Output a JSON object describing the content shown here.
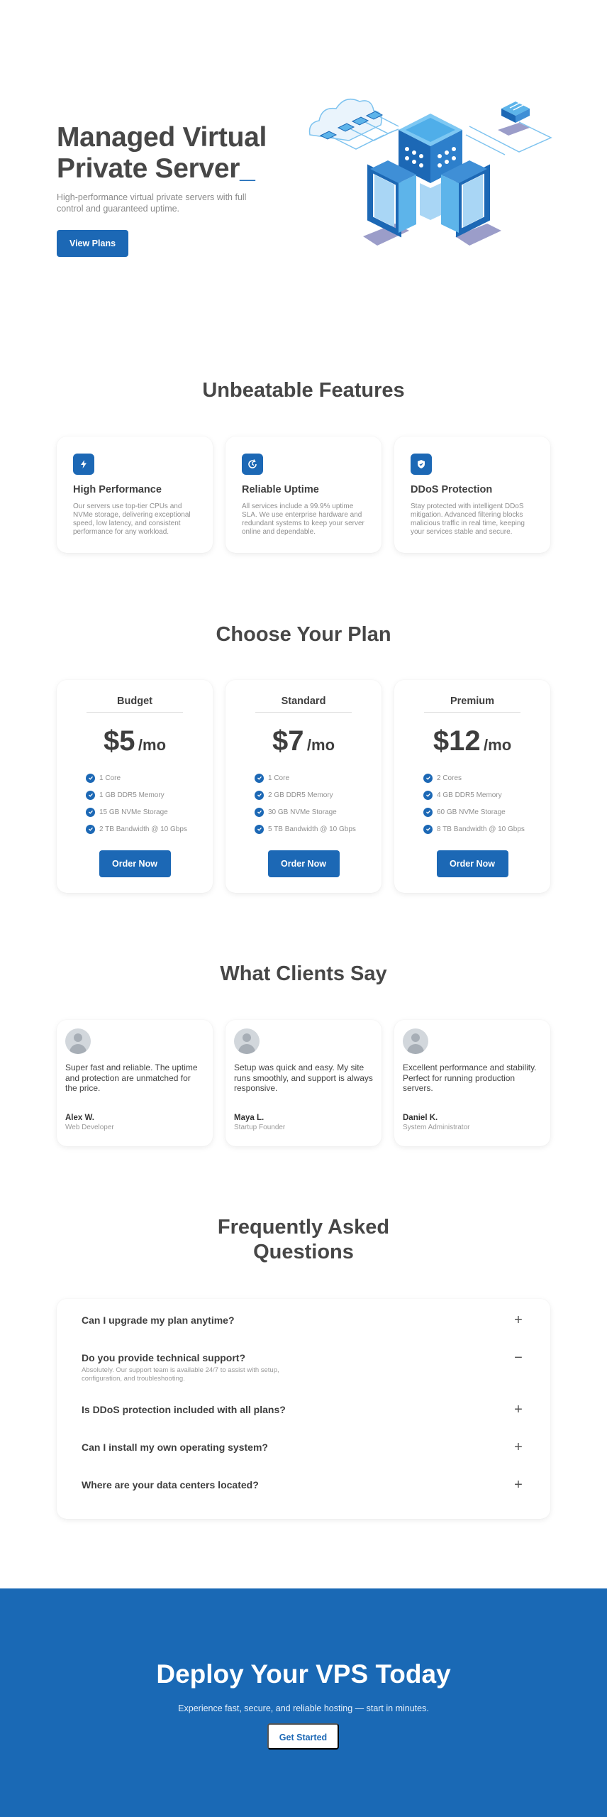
{
  "hero": {
    "title_line1": "Managed Virtual",
    "title_line2": "Private Server",
    "cursor": "_",
    "subtitle": "High-performance virtual private servers with full control and guaranteed uptime.",
    "button": "View Plans"
  },
  "features": {
    "title": "Unbeatable Features",
    "items": [
      {
        "icon": "bolt-icon",
        "title": "High Performance",
        "desc": "Our servers use top-tier CPUs and NVMe storage, delivering exceptional speed, low latency, and consistent performance for any workload."
      },
      {
        "icon": "clock-refresh-icon",
        "title": "Reliable Uptime",
        "desc": "All services include a 99.9% uptime SLA. We use enterprise hardware and redundant systems to keep your server online and dependable."
      },
      {
        "icon": "shield-icon",
        "title": "DDoS Protection",
        "desc": "Stay protected with intelligent DDoS mitigation. Advanced filtering blocks malicious traffic in real time, keeping your services stable and secure."
      }
    ]
  },
  "plans": {
    "title": "Choose Your Plan",
    "items": [
      {
        "name": "Budget",
        "price": "$5",
        "per": "/mo",
        "features": [
          "1 Core",
          "1 GB DDR5 Memory",
          "15 GB NVMe Storage",
          "2 TB Bandwidth @ 10 Gbps"
        ],
        "button": "Order Now"
      },
      {
        "name": "Standard",
        "price": "$7",
        "per": "/mo",
        "features": [
          "1 Core",
          "2 GB DDR5 Memory",
          "30 GB NVMe Storage",
          "5 TB Bandwidth @ 10 Gbps"
        ],
        "button": "Order Now"
      },
      {
        "name": "Premium",
        "price": "$12",
        "per": "/mo",
        "features": [
          "2 Cores",
          "4 GB DDR5 Memory",
          "60 GB NVMe Storage",
          "8 TB Bandwidth @ 10 Gbps"
        ],
        "button": "Order Now"
      }
    ]
  },
  "testimonials": {
    "title": "What Clients Say",
    "items": [
      {
        "quote": "Super fast and reliable. The uptime and protection are unmatched for the price.",
        "name": "Alex W.",
        "role": "Web Developer"
      },
      {
        "quote": "Setup was quick and easy. My site runs smoothly, and support is always responsive.",
        "name": "Maya L.",
        "role": "Startup Founder"
      },
      {
        "quote": "Excellent performance and stability. Perfect for running production servers.",
        "name": "Daniel K.",
        "role": "System Administrator"
      }
    ]
  },
  "faq": {
    "title_line1": "Frequently Asked",
    "title_line2": "Questions",
    "items": [
      {
        "q": "Can I upgrade my plan anytime?",
        "sign": "+",
        "open": false,
        "a": ""
      },
      {
        "q": "Do you provide technical support?",
        "sign": "−",
        "open": true,
        "a": "Absolutely. Our support team is available 24/7 to assist with setup, configuration, and troubleshooting."
      },
      {
        "q": "Is DDoS protection included with all plans?",
        "sign": "+",
        "open": false,
        "a": ""
      },
      {
        "q": "Can I install my own operating system?",
        "sign": "+",
        "open": false,
        "a": ""
      },
      {
        "q": "Where are your data centers located?",
        "sign": "+",
        "open": false,
        "a": ""
      }
    ]
  },
  "cta": {
    "title": "Deploy Your VPS Today",
    "subtitle": "Experience fast, secure, and reliable hosting — start in minutes.",
    "button": "Get Started"
  },
  "colors": {
    "accent": "#1c68b5",
    "cta_background": "#1a69b5",
    "heading": "#474747"
  }
}
